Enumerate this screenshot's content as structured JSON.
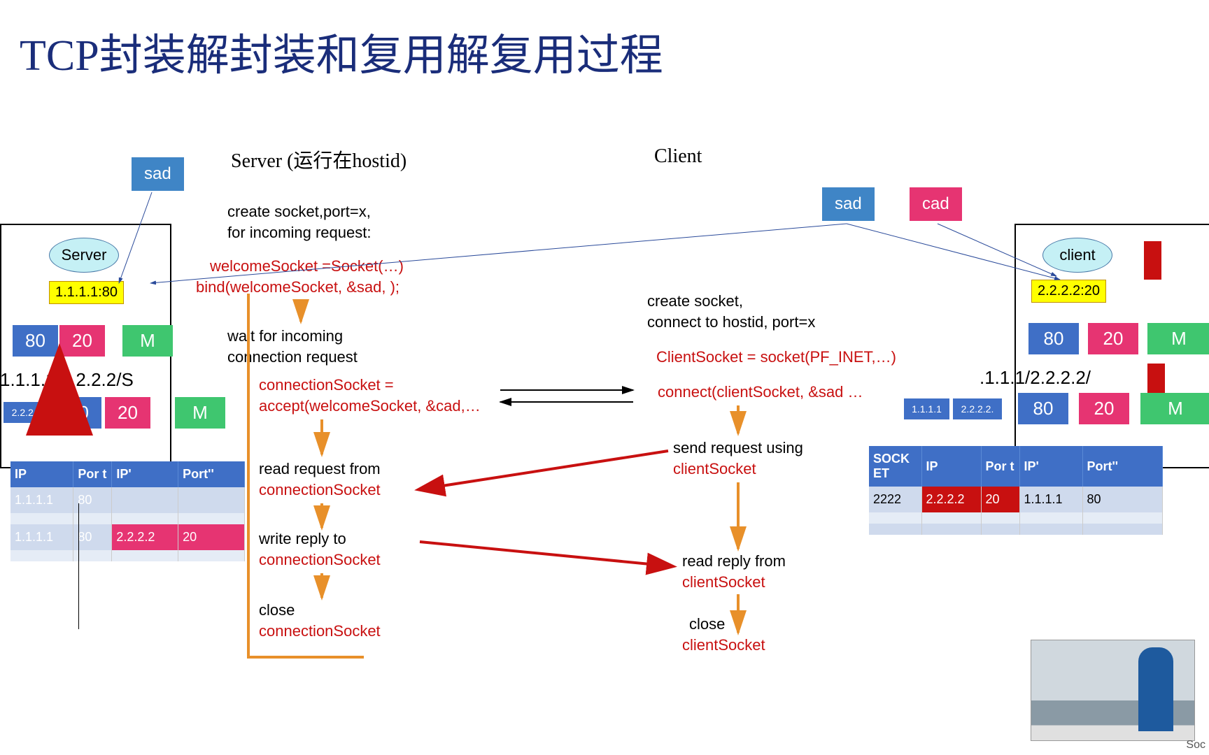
{
  "title": "TCP封装解封装和复用解复用过程",
  "server_header": "Server (运行在hostid)",
  "client_header": "Client",
  "labels": {
    "sad": "sad",
    "cad": "cad",
    "server": "Server",
    "client": "client",
    "server_addr": "1.1.1.1:80",
    "client_addr": "2.2.2.2:20",
    "M": "M",
    "p80": "80",
    "p20": "20",
    "ip_line": "1.1.1.1/2.2.2.2/S",
    "ip_line2": ".1.1.1/2.2.2.2/",
    "ip1s": "2.2.2.2.",
    "ip1c": "1.1.1.1",
    "ip2c": "2.2.2.2."
  },
  "server_steps": {
    "s1a": "create socket,port=x,",
    "s1b": " for incoming request:",
    "s2a": "welcomeSocket =Socket(…)",
    "s2b": "bind(welcomeSocket, &sad, );",
    "s3a": "wait for incoming",
    "s3b": "connection request",
    "s4a": "connectionSocket =",
    "s4b": "accept(welcomeSocket, &cad,…",
    "s5a": "read request from",
    "s5b": "connectionSocket",
    "s6a": "write reply to",
    "s6b": "connectionSocket",
    "s7a": "close",
    "s7b": "connectionSocket"
  },
  "client_steps": {
    "c1a": "create socket,",
    "c1b": "connect to hostid, port=x",
    "c2a": "ClientSocket = socket(PF_INET,…)",
    "c2b": "connect(clientSocket, &sad …",
    "c3a": "send request using",
    "c3b": "clientSocket",
    "c4a": "read reply from",
    "c4b": "clientSocket",
    "c5a": "close",
    "c5b": "clientSocket"
  },
  "server_table": {
    "headers": [
      "IP",
      "Por t",
      "IP'",
      "Port''"
    ],
    "rows": [
      [
        "1.1.1.1",
        "80",
        "",
        ""
      ],
      [
        "1.1.1.1",
        "80",
        "2.2.2.2",
        "20"
      ]
    ]
  },
  "client_table": {
    "headers": [
      "SOCK ET",
      "IP",
      "Por t",
      "IP'",
      "Port''"
    ],
    "rows": [
      [
        "2222",
        "2.2.2.2",
        "20",
        "1.1.1.1",
        "80"
      ]
    ]
  },
  "footer": "Soc"
}
